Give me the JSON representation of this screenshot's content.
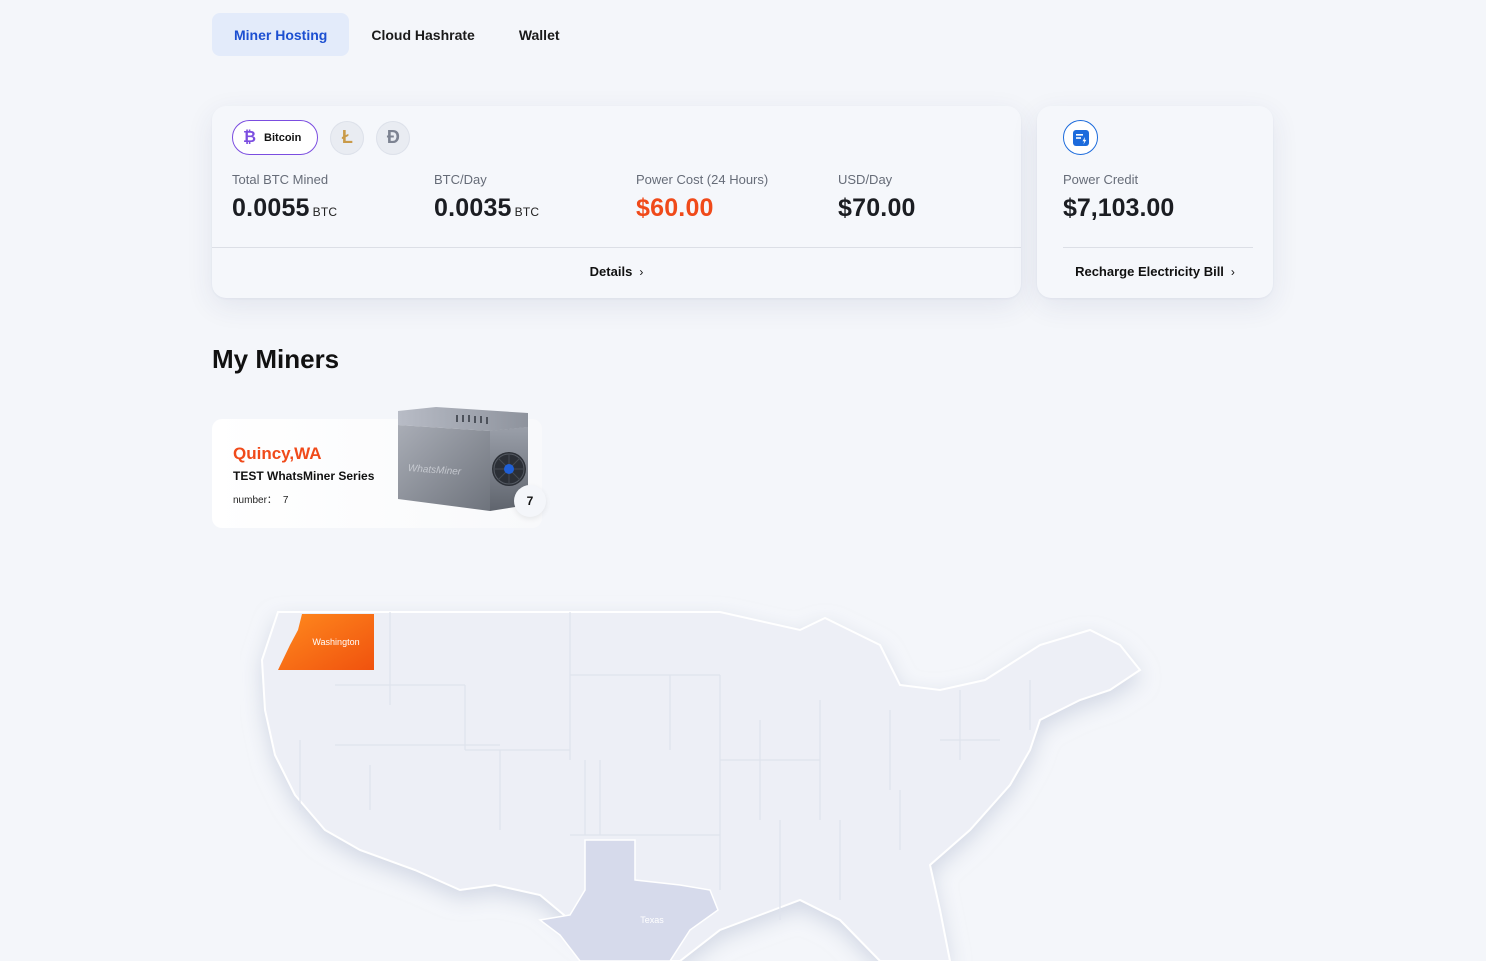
{
  "tabs": [
    {
      "label": "Miner Hosting",
      "active": true
    },
    {
      "label": "Cloud Hashrate",
      "active": false
    },
    {
      "label": "Wallet",
      "active": false
    }
  ],
  "coins": {
    "selected_label": "Bitcoin",
    "options": [
      {
        "icon": "bitcoin-icon",
        "glyph": "₿"
      },
      {
        "icon": "litecoin-icon",
        "glyph": "Ł"
      },
      {
        "icon": "dogecoin-icon",
        "glyph": "Đ"
      }
    ]
  },
  "stats": {
    "total_mined": {
      "label": "Total BTC Mined",
      "value": "0.0055",
      "unit": "BTC"
    },
    "btc_day": {
      "label": "BTC/Day",
      "value": "0.0035",
      "unit": "BTC"
    },
    "power_cost": {
      "label": "Power Cost (24 Hours)",
      "value": "$60.00"
    },
    "usd_day": {
      "label": "USD/Day",
      "value": "$70.00"
    }
  },
  "details_link": "Details",
  "power": {
    "label": "Power Credit",
    "value": "$7,103.00",
    "link": "Recharge Electricity Bill"
  },
  "section_title": "My Miners",
  "miner": {
    "location": "Quincy,WA",
    "series": "TEST WhatsMiner Series",
    "number_label": "number：",
    "number_value": "7",
    "badge": "7",
    "brand_text": "WhatsMiner"
  },
  "map": {
    "highlight_state": "Washington",
    "secondary_state": "Texas"
  },
  "colors": {
    "accent_blue": "#1c4fd1",
    "accent_orange": "#f04a1a",
    "bitcoin_purple": "#7b4de0",
    "map_fill": "#edeff6"
  }
}
